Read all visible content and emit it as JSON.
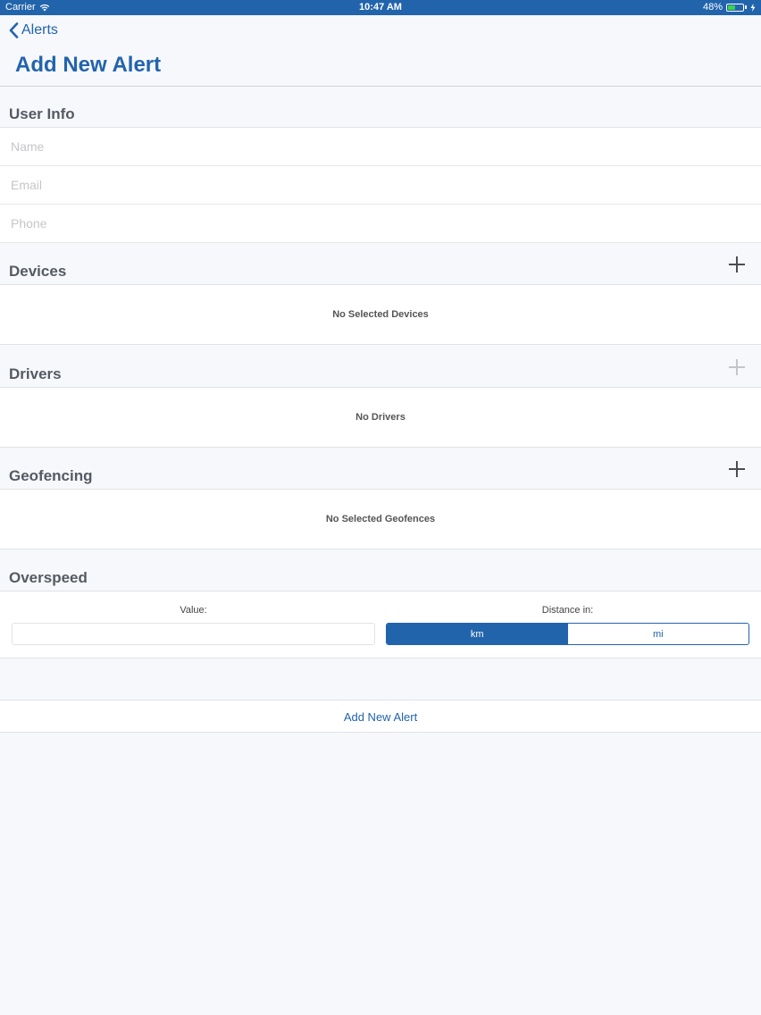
{
  "status_bar": {
    "carrier": "Carrier",
    "time": "10:47 AM",
    "battery": "48%",
    "battery_level": 0.48
  },
  "nav": {
    "back_label": "Alerts",
    "title": "Add New Alert"
  },
  "user_info": {
    "title": "User Info",
    "name_placeholder": "Name",
    "email_placeholder": "Email",
    "phone_placeholder": "Phone"
  },
  "devices": {
    "title": "Devices",
    "empty_text": "No Selected Devices"
  },
  "drivers": {
    "title": "Drivers",
    "empty_text": "No Drivers"
  },
  "geofencing": {
    "title": "Geofencing",
    "empty_text": "No Selected Geofences"
  },
  "overspeed": {
    "title": "Overspeed",
    "value_label": "Value:",
    "value": "",
    "distance_label": "Distance in:",
    "units": [
      "km",
      "mi"
    ],
    "selected_unit": "km"
  },
  "submit_label": "Add New Alert",
  "colors": {
    "accent": "#2264ac",
    "background": "#f7f8fc"
  }
}
